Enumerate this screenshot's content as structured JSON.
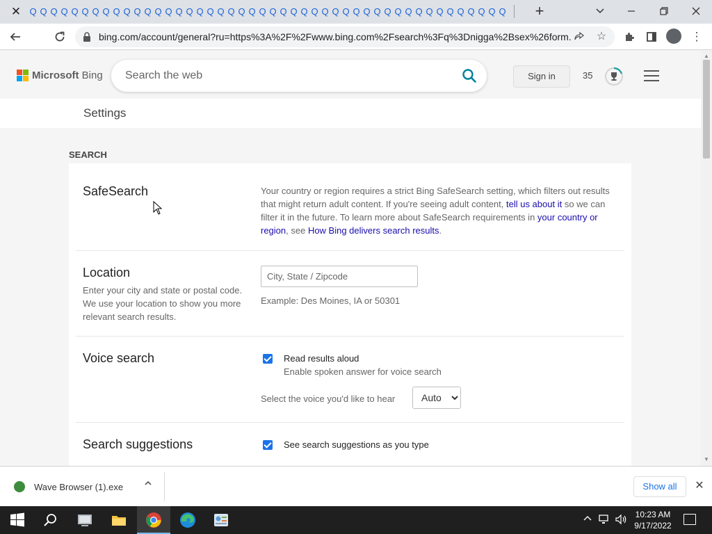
{
  "browser": {
    "tab_glyph": "Q",
    "tab_count": 46,
    "url": "bing.com/account/general?ru=https%3A%2F%2Fwww.bing.com%2Fsearch%3Fq%3Dnigga%2Bsex%26form..."
  },
  "header": {
    "logo_bold": "Microsoft",
    "logo_thin": " Bing",
    "search_placeholder": "Search the web",
    "signin_label": "Sign in",
    "rewards_count": "35"
  },
  "settings": {
    "page_title": "Settings",
    "section_heading": "SEARCH",
    "safesearch": {
      "title": "SafeSearch",
      "text_1": "Your country or region requires a strict Bing SafeSearch setting, which filters out results that might return adult content. If you're seeing adult content, ",
      "link_1": "tell us about it",
      "text_2": " so we can filter it in the future. To learn more about SafeSearch requirements in ",
      "link_2": "your country or region",
      "text_3": ", see ",
      "link_3": "How Bing delivers search results",
      "text_4": "."
    },
    "location": {
      "title": "Location",
      "description": "Enter your city and state or postal code. We use your location to show you more relevant search results.",
      "placeholder": "City, State / Zipcode",
      "example": "Example: Des Moines, IA or 50301"
    },
    "voice": {
      "title": "Voice search",
      "checkbox_label": "Read results aloud",
      "checkbox_sub": "Enable spoken answer for voice search",
      "voice_prompt": "Select the voice you'd like to hear",
      "voice_value": "Auto"
    },
    "suggestions": {
      "title": "Search suggestions",
      "checkbox_label": "See search suggestions as you type"
    }
  },
  "downloads": {
    "file_name": "Wave Browser (1).exe",
    "show_all": "Show all"
  },
  "taskbar": {
    "time": "10:23 AM",
    "date": "9/17/2022"
  },
  "colors": {
    "link": "#1a0dab",
    "accent": "#1a73e8",
    "search_icon": "#00809d"
  }
}
